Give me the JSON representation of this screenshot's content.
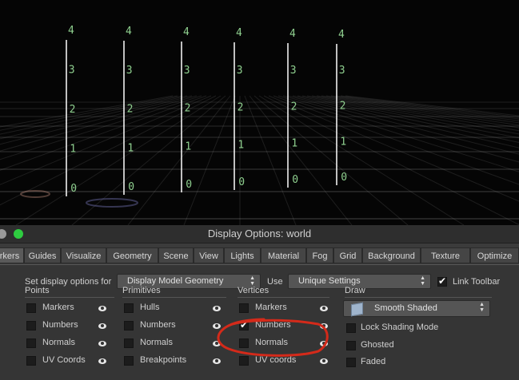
{
  "viewport": {
    "columns": [
      {
        "numbers": [
          "4",
          "3",
          "2",
          "1",
          "0"
        ]
      },
      {
        "numbers": [
          "4",
          "3",
          "2",
          "1",
          "0"
        ]
      },
      {
        "numbers": [
          "4",
          "3",
          "2",
          "1",
          "0"
        ]
      },
      {
        "numbers": [
          "4",
          "3",
          "2",
          "1",
          "0"
        ]
      },
      {
        "numbers": [
          "4",
          "3",
          "2",
          "1",
          "0"
        ]
      },
      {
        "numbers": [
          "4",
          "3",
          "2",
          "1",
          "0"
        ]
      }
    ],
    "number_color": "#8fd08f"
  },
  "window": {
    "title": "Display Options:  world",
    "traffic_colors": [
      "#9a9a9a",
      "#2ecc40"
    ]
  },
  "tabs": [
    "rkers",
    "Guides",
    "Visualize",
    "Geometry",
    "Scene",
    "View",
    "Lights",
    "Material",
    "Fog",
    "Grid",
    "Background",
    "Texture",
    "Optimize"
  ],
  "settings": {
    "set_label": "Set display options for",
    "set_value": "Display Model Geometry",
    "use_label": "Use",
    "use_value": "Unique Settings",
    "link_label": "Link Toolbar"
  },
  "sections": {
    "points": {
      "title": "Points",
      "items": [
        "Markers",
        "Numbers",
        "Normals",
        "UV Coords"
      ]
    },
    "primitives": {
      "title": "Primitives",
      "items": [
        "Hulls",
        "Numbers",
        "Normals",
        "Breakpoints"
      ]
    },
    "vertices": {
      "title": "Vertices",
      "items": [
        "Markers",
        "Numbers",
        "Normals",
        "UV coords"
      ]
    },
    "draw": {
      "title": "Draw",
      "mode": "Smooth Shaded",
      "options": [
        "Lock Shading Mode",
        "Ghosted",
        "Faded"
      ]
    }
  },
  "annotation_color": "#d42a1a"
}
